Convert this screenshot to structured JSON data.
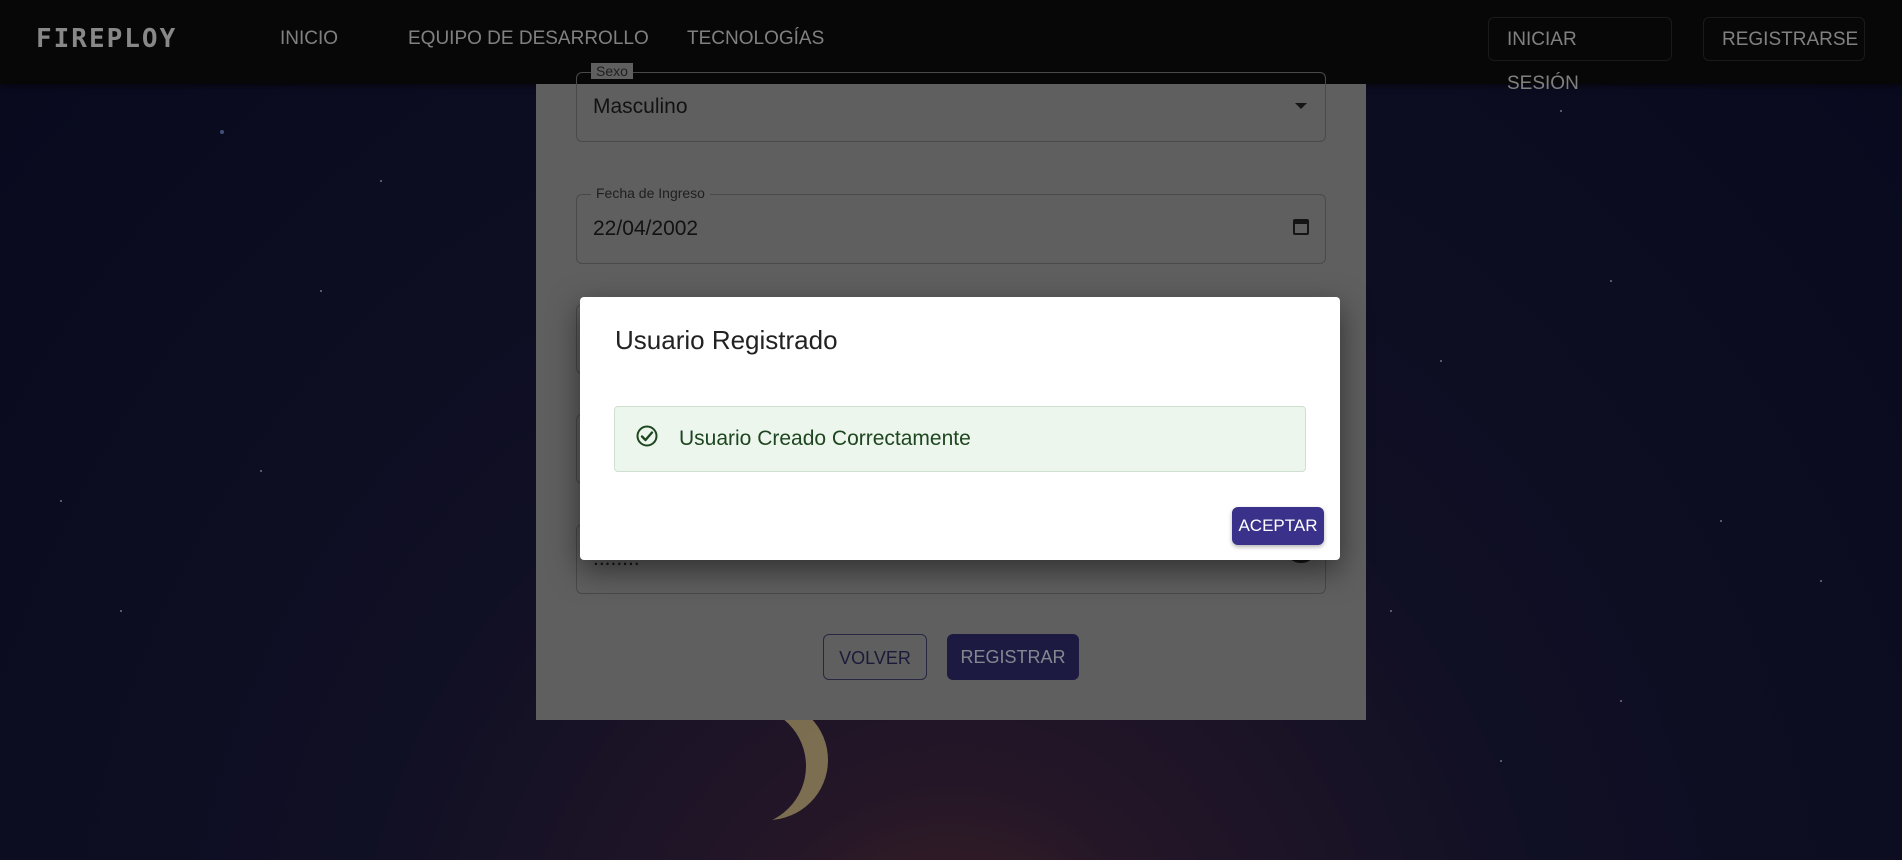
{
  "navbar": {
    "brand": "FIREPLOY",
    "links": [
      "INICIO",
      "EQUIPO DE DESARROLLO",
      "TECNOLOGÍAS"
    ],
    "login": "INICIAR SESIÓN",
    "register": "REGISTRARSE"
  },
  "form": {
    "sexo": {
      "label": "Sexo",
      "value": "Masculino"
    },
    "fecha_ingreso": {
      "label": "Fecha de Ingreso",
      "value": "22/04/2002"
    },
    "password": {
      "value": "........"
    },
    "volver": "VOLVER",
    "registrar": "REGISTRAR"
  },
  "dialog": {
    "title": "Usuario Registrado",
    "message": "Usuario Creado Correctamente",
    "accept": "ACEPTAR"
  },
  "colors": {
    "primary": "#3a328a",
    "success_bg": "#ecf6ed",
    "success_text": "#1e4620"
  },
  "icons": [
    "dropdown-caret-icon",
    "calendar-icon",
    "visibility-icon",
    "check-circle-icon"
  ]
}
